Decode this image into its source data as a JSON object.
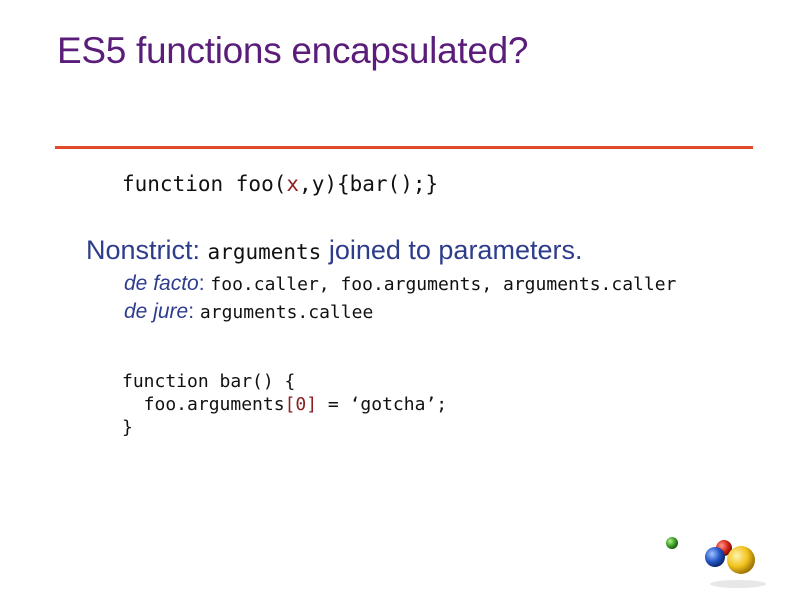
{
  "slide": {
    "title": "ES5 functions encapsulated?",
    "code_top": {
      "prefix": "function foo(",
      "param_x": "x",
      "comma": ",",
      "param_y": "y",
      "suffix": "){bar();}"
    },
    "nonstrict": {
      "label": "Nonstrict: ",
      "code": "arguments",
      "text": " joined to parameters."
    },
    "de_facto": {
      "label": "de facto",
      "sep": ": ",
      "code": "foo.caller, foo.arguments, arguments.caller"
    },
    "de_jure": {
      "label": "de jure",
      "sep": ": ",
      "code": "arguments.callee"
    },
    "code_block": {
      "line1": "function bar() {",
      "line2_prefix": "  foo.arguments",
      "line2_index": "[0]",
      "line2_suffix": " = ‘gotcha’;",
      "line3": "}"
    }
  },
  "colors": {
    "title": "#5a1d7a",
    "rule": "#e04a2b",
    "accent_text": "#2e3c8c",
    "code": "#111111",
    "code_highlight": "#8b1e1e"
  },
  "icons": {
    "logo": "colored-balls-logo-icon"
  }
}
